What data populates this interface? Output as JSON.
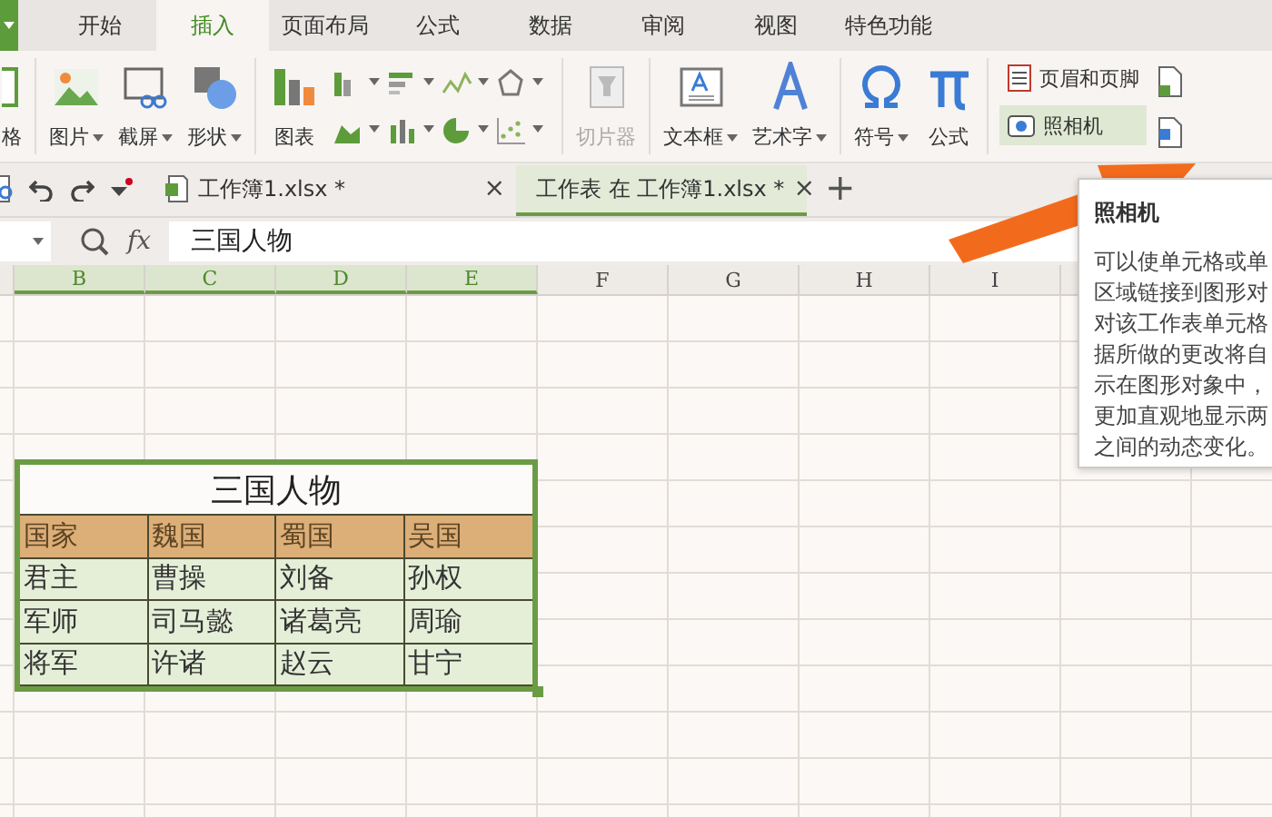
{
  "menu_tabs": [
    {
      "label": "开始",
      "selected": false
    },
    {
      "label": "插入",
      "selected": true
    },
    {
      "label": "页面布局",
      "selected": false
    },
    {
      "label": "公式",
      "selected": false
    },
    {
      "label": "数据",
      "selected": false
    },
    {
      "label": "审阅",
      "selected": false
    },
    {
      "label": "视图",
      "selected": false
    },
    {
      "label": "特色功能",
      "selected": false
    }
  ],
  "ribbon": {
    "groups": [
      {
        "items": [
          {
            "kind": "big",
            "label": "格",
            "dropdown": false,
            "disabled": false
          }
        ]
      },
      {
        "items": [
          {
            "kind": "big",
            "label": "图片",
            "dropdown": true,
            "disabled": false
          },
          {
            "kind": "big",
            "label": "截屏",
            "dropdown": true,
            "disabled": false
          },
          {
            "kind": "big",
            "label": "形状",
            "dropdown": true,
            "disabled": false
          }
        ]
      },
      {
        "items": [
          {
            "kind": "big",
            "label": "图表",
            "dropdown": false,
            "disabled": false
          },
          {
            "kind": "chart-grid"
          }
        ]
      },
      {
        "items": [
          {
            "kind": "big",
            "label": "切片器",
            "dropdown": false,
            "disabled": true
          }
        ]
      },
      {
        "items": [
          {
            "kind": "big",
            "label": "文本框",
            "dropdown": true,
            "disabled": false
          },
          {
            "kind": "big",
            "label": "艺术字",
            "dropdown": true,
            "disabled": false
          }
        ]
      },
      {
        "items": [
          {
            "kind": "big",
            "label": "符号",
            "dropdown": true,
            "disabled": false
          },
          {
            "kind": "big",
            "label": "公式",
            "dropdown": false,
            "disabled": false
          }
        ]
      },
      {
        "items": [
          {
            "kind": "stack",
            "rows": [
              {
                "label": "页眉和页脚",
                "selected": false
              },
              {
                "label": "照相机",
                "selected": true
              }
            ]
          }
        ]
      }
    ]
  },
  "doc_tabs": [
    {
      "label": "工作簿1.xlsx *",
      "selected": false,
      "close": "×"
    },
    {
      "label": "工作表 在 工作簿1.xlsx *",
      "selected": true,
      "close": "×"
    }
  ],
  "new_tab": "+",
  "formula_bar": {
    "fx": "fx",
    "value": "三国人物"
  },
  "columns": [
    {
      "label": "B",
      "selected": true
    },
    {
      "label": "C",
      "selected": true
    },
    {
      "label": "D",
      "selected": true
    },
    {
      "label": "E",
      "selected": true
    },
    {
      "label": "F",
      "selected": false
    },
    {
      "label": "G",
      "selected": false
    },
    {
      "label": "H",
      "selected": false
    },
    {
      "label": "I",
      "selected": false
    }
  ],
  "table": {
    "title": "三国人物",
    "header": [
      "国家",
      "魏国",
      "蜀国",
      "吴国"
    ],
    "rows": [
      [
        "君主",
        "曹操",
        "刘备",
        "孙权"
      ],
      [
        "军师",
        "司马懿",
        "诸葛亮",
        "周瑜"
      ],
      [
        "将军",
        "许诸",
        "赵云",
        "甘宁"
      ]
    ]
  },
  "tooltip": {
    "title": "照相机",
    "lines": [
      "可以使单元格或单",
      "区域链接到图形对",
      "对该工作表单元格",
      "据所做的更改将自",
      "示在图形对象中，",
      "更加直观地显示两",
      "之间的动态变化。"
    ]
  }
}
